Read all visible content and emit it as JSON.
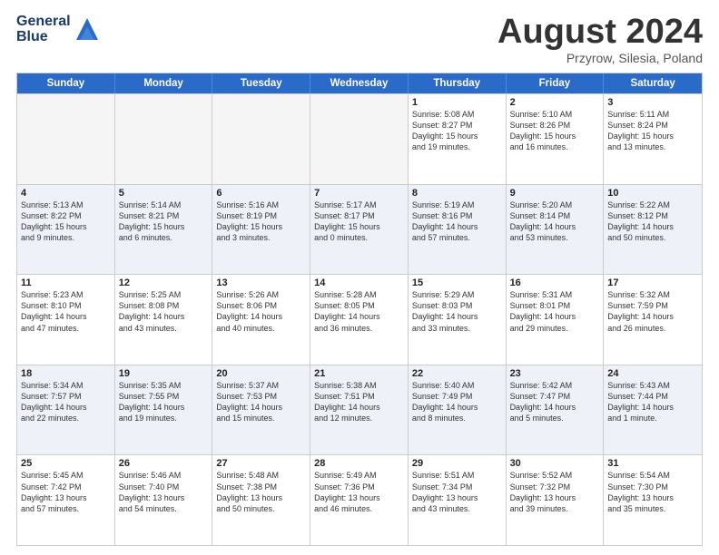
{
  "header": {
    "logo_line1": "General",
    "logo_line2": "Blue",
    "month_title": "August 2024",
    "location": "Przyrow, Silesia, Poland"
  },
  "days_of_week": [
    "Sunday",
    "Monday",
    "Tuesday",
    "Wednesday",
    "Thursday",
    "Friday",
    "Saturday"
  ],
  "rows": [
    [
      {
        "day": "",
        "text": "",
        "empty": true
      },
      {
        "day": "",
        "text": "",
        "empty": true
      },
      {
        "day": "",
        "text": "",
        "empty": true
      },
      {
        "day": "",
        "text": "",
        "empty": true
      },
      {
        "day": "1",
        "text": "Sunrise: 5:08 AM\nSunset: 8:27 PM\nDaylight: 15 hours\nand 19 minutes."
      },
      {
        "day": "2",
        "text": "Sunrise: 5:10 AM\nSunset: 8:26 PM\nDaylight: 15 hours\nand 16 minutes."
      },
      {
        "day": "3",
        "text": "Sunrise: 5:11 AM\nSunset: 8:24 PM\nDaylight: 15 hours\nand 13 minutes."
      }
    ],
    [
      {
        "day": "4",
        "text": "Sunrise: 5:13 AM\nSunset: 8:22 PM\nDaylight: 15 hours\nand 9 minutes."
      },
      {
        "day": "5",
        "text": "Sunrise: 5:14 AM\nSunset: 8:21 PM\nDaylight: 15 hours\nand 6 minutes."
      },
      {
        "day": "6",
        "text": "Sunrise: 5:16 AM\nSunset: 8:19 PM\nDaylight: 15 hours\nand 3 minutes."
      },
      {
        "day": "7",
        "text": "Sunrise: 5:17 AM\nSunset: 8:17 PM\nDaylight: 15 hours\nand 0 minutes."
      },
      {
        "day": "8",
        "text": "Sunrise: 5:19 AM\nSunset: 8:16 PM\nDaylight: 14 hours\nand 57 minutes."
      },
      {
        "day": "9",
        "text": "Sunrise: 5:20 AM\nSunset: 8:14 PM\nDaylight: 14 hours\nand 53 minutes."
      },
      {
        "day": "10",
        "text": "Sunrise: 5:22 AM\nSunset: 8:12 PM\nDaylight: 14 hours\nand 50 minutes."
      }
    ],
    [
      {
        "day": "11",
        "text": "Sunrise: 5:23 AM\nSunset: 8:10 PM\nDaylight: 14 hours\nand 47 minutes."
      },
      {
        "day": "12",
        "text": "Sunrise: 5:25 AM\nSunset: 8:08 PM\nDaylight: 14 hours\nand 43 minutes."
      },
      {
        "day": "13",
        "text": "Sunrise: 5:26 AM\nSunset: 8:06 PM\nDaylight: 14 hours\nand 40 minutes."
      },
      {
        "day": "14",
        "text": "Sunrise: 5:28 AM\nSunset: 8:05 PM\nDaylight: 14 hours\nand 36 minutes."
      },
      {
        "day": "15",
        "text": "Sunrise: 5:29 AM\nSunset: 8:03 PM\nDaylight: 14 hours\nand 33 minutes."
      },
      {
        "day": "16",
        "text": "Sunrise: 5:31 AM\nSunset: 8:01 PM\nDaylight: 14 hours\nand 29 minutes."
      },
      {
        "day": "17",
        "text": "Sunrise: 5:32 AM\nSunset: 7:59 PM\nDaylight: 14 hours\nand 26 minutes."
      }
    ],
    [
      {
        "day": "18",
        "text": "Sunrise: 5:34 AM\nSunset: 7:57 PM\nDaylight: 14 hours\nand 22 minutes."
      },
      {
        "day": "19",
        "text": "Sunrise: 5:35 AM\nSunset: 7:55 PM\nDaylight: 14 hours\nand 19 minutes."
      },
      {
        "day": "20",
        "text": "Sunrise: 5:37 AM\nSunset: 7:53 PM\nDaylight: 14 hours\nand 15 minutes."
      },
      {
        "day": "21",
        "text": "Sunrise: 5:38 AM\nSunset: 7:51 PM\nDaylight: 14 hours\nand 12 minutes."
      },
      {
        "day": "22",
        "text": "Sunrise: 5:40 AM\nSunset: 7:49 PM\nDaylight: 14 hours\nand 8 minutes."
      },
      {
        "day": "23",
        "text": "Sunrise: 5:42 AM\nSunset: 7:47 PM\nDaylight: 14 hours\nand 5 minutes."
      },
      {
        "day": "24",
        "text": "Sunrise: 5:43 AM\nSunset: 7:44 PM\nDaylight: 14 hours\nand 1 minute."
      }
    ],
    [
      {
        "day": "25",
        "text": "Sunrise: 5:45 AM\nSunset: 7:42 PM\nDaylight: 13 hours\nand 57 minutes."
      },
      {
        "day": "26",
        "text": "Sunrise: 5:46 AM\nSunset: 7:40 PM\nDaylight: 13 hours\nand 54 minutes."
      },
      {
        "day": "27",
        "text": "Sunrise: 5:48 AM\nSunset: 7:38 PM\nDaylight: 13 hours\nand 50 minutes."
      },
      {
        "day": "28",
        "text": "Sunrise: 5:49 AM\nSunset: 7:36 PM\nDaylight: 13 hours\nand 46 minutes."
      },
      {
        "day": "29",
        "text": "Sunrise: 5:51 AM\nSunset: 7:34 PM\nDaylight: 13 hours\nand 43 minutes."
      },
      {
        "day": "30",
        "text": "Sunrise: 5:52 AM\nSunset: 7:32 PM\nDaylight: 13 hours\nand 39 minutes."
      },
      {
        "day": "31",
        "text": "Sunrise: 5:54 AM\nSunset: 7:30 PM\nDaylight: 13 hours\nand 35 minutes."
      }
    ]
  ]
}
